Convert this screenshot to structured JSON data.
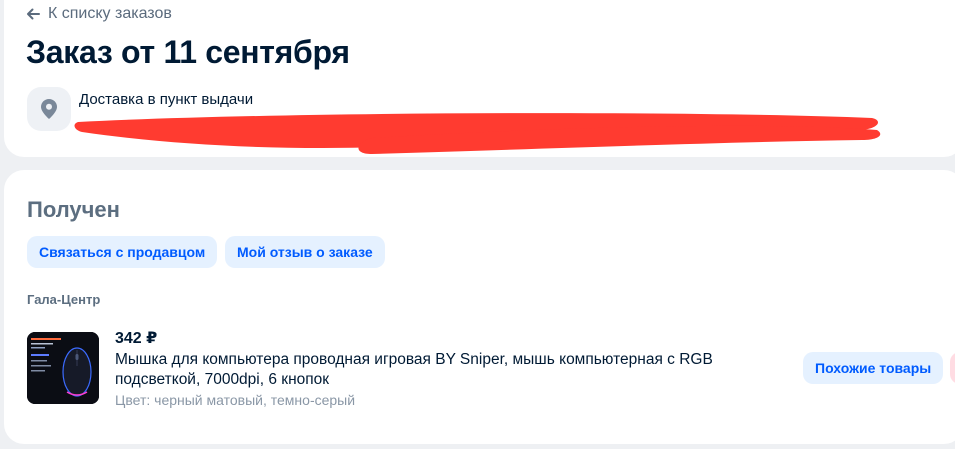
{
  "nav": {
    "back_label": "К списку заказов",
    "back_icon": "arrow-left-icon"
  },
  "order": {
    "title": "Заказ от 11 сентября",
    "delivery_label": "Доставка в пункт выдачи",
    "delivery_icon": "map-pin-icon"
  },
  "status": {
    "title": "Получен",
    "contact_seller_label": "Связаться с продавцом",
    "my_review_label": "Мой отзыв о заказе"
  },
  "seller": {
    "name": "Гала-Центр"
  },
  "product": {
    "price": "342 ₽",
    "name": "Мышка для компьютера проводная игровая BY Sniper, мышь компьютерная с RGB подсветкой, 7000dpi, 6 кнопок",
    "color": "Цвет: черный матовый, темно-серый",
    "similar_label": "Похожие товары"
  },
  "colors": {
    "accent": "#005bff",
    "pill_bg": "#e5f1ff",
    "redaction": "#ff3b30"
  }
}
